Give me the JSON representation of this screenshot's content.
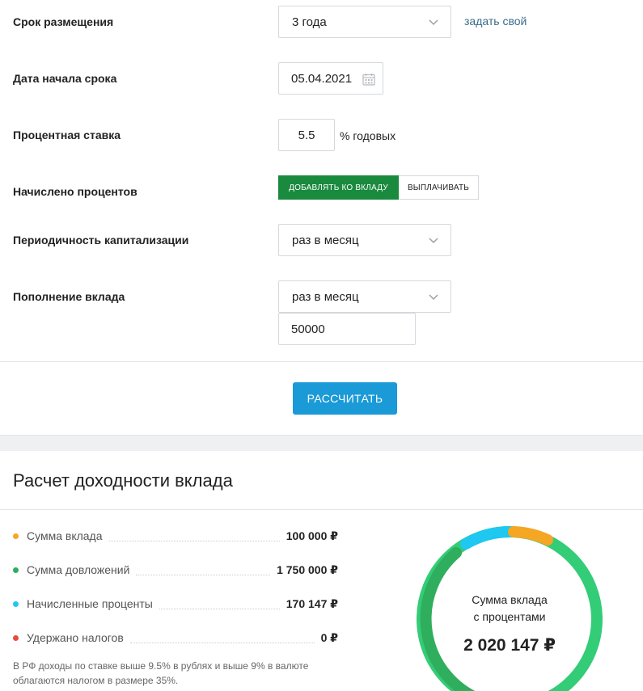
{
  "form": {
    "term_label": "Срок размещения",
    "term_value": "3 года",
    "term_custom_link": "задать свой",
    "start_date_label": "Дата начала срока",
    "start_date_value": "05.04.2021",
    "rate_label": "Процентная ставка",
    "rate_value": "5.5",
    "rate_suffix": "% годовых",
    "interest_label": "Начислено процентов",
    "interest_options": [
      "ДОБАВЛЯТЬ КО ВКЛАДУ",
      "ВЫПЛАЧИВАТЬ"
    ],
    "capitalization_label": "Периодичность капитализации",
    "capitalization_value": "раз в месяц",
    "topup_label": "Пополнение вклада",
    "topup_value": "раз в месяц",
    "topup_amount": "50000",
    "calculate_label": "РАССЧИТАТЬ"
  },
  "results": {
    "title": "Расчет доходности вклада",
    "stats": [
      {
        "name": "Сумма вклада",
        "value": "100 000 ₽",
        "color": "#f5a623"
      },
      {
        "name": "Сумма довложений",
        "value": "1 750 000 ₽",
        "color": "#2fae5e"
      },
      {
        "name": "Начисленные проценты",
        "value": "170 147 ₽",
        "color": "#1ec8f0"
      },
      {
        "name": "Удержано налогов",
        "value": "0 ₽",
        "color": "#e74c3c"
      }
    ],
    "note": "В РФ доходы по ставке выше 9.5% в рублях и выше 9% в валюте облагаются налогом в размере 35%.",
    "donut_label_line1": "Сумма вклада",
    "donut_label_line2": "с процентами",
    "donut_total": "2 020 147 ₽",
    "colors": {
      "deposit": "#f5a623",
      "topups": "#2fae5e",
      "interest": "#1ec8f0",
      "accent": "#1a9ad6",
      "toggle_active": "#1a8a3e"
    }
  }
}
